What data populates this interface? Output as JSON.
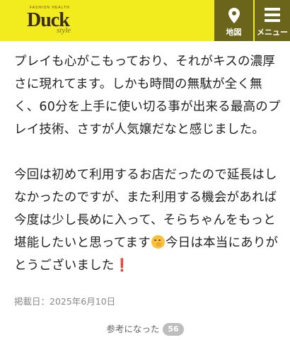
{
  "header": {
    "logo": {
      "tagline": "FASHION HEALTH",
      "wordmark": "Duck",
      "subtitle": "style"
    },
    "nav": {
      "map_label": "地図",
      "menu_label": "メニュー"
    },
    "background_color": "#f2ec1f",
    "button_color": "#6a651b"
  },
  "review": {
    "paragraph1": "プレイも心がこもっており、それがキスの濃厚さに現れてます。しかも時間の無駄が全く無く、60分を上手に使い切る事が出来る最高のプレイ技術、さすが人気嬢だなと感じました。",
    "paragraph2_part1": "今回は初めて利用するお店だったので延長はしなかったのですが、また利用する機会があれば今度は少し長めに入って、そらちゃんをもっと堪能したいと思ってます",
    "paragraph2_part2": "今日は本当にありがとうございました",
    "exclamation": "❗",
    "emoji": "hugging-face-emoji",
    "posted_date": "掲載日：2025年6月10日"
  },
  "helpful": {
    "label": "参考になった",
    "count": "56"
  }
}
